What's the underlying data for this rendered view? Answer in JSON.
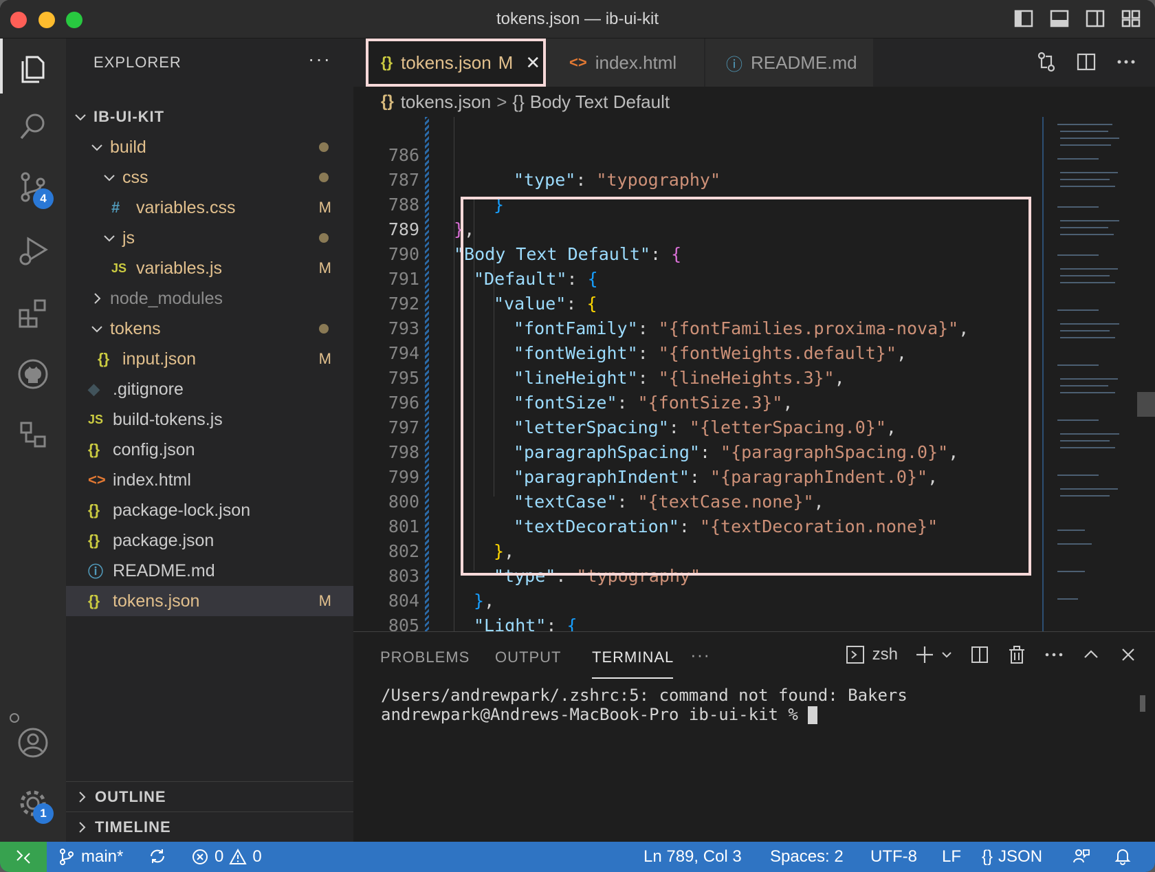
{
  "window": {
    "title": "tokens.json — ib-ui-kit"
  },
  "activity_bar": {
    "scm_badge": "4",
    "settings_badge": "1"
  },
  "sidebar": {
    "header": "EXPLORER",
    "more": "···",
    "root": "IB-UI-KIT",
    "tree": [
      {
        "label": "build",
        "icon": "",
        "git": "dot"
      },
      {
        "label": "css",
        "icon": "",
        "git": "dot"
      },
      {
        "label": "variables.css",
        "icon": "#",
        "git": "M"
      },
      {
        "label": "js",
        "icon": "",
        "git": "dot"
      },
      {
        "label": "variables.js",
        "icon": "JS",
        "git": "M"
      },
      {
        "label": "node_modules",
        "icon": "",
        "git": ""
      },
      {
        "label": "tokens",
        "icon": "",
        "git": "dot"
      },
      {
        "label": "input.json",
        "icon": "{}",
        "git": "M"
      },
      {
        "label": ".gitignore",
        "icon": "◆",
        "git": ""
      },
      {
        "label": "build-tokens.js",
        "icon": "JS",
        "git": ""
      },
      {
        "label": "config.json",
        "icon": "{}",
        "git": ""
      },
      {
        "label": "index.html",
        "icon": "<>",
        "git": ""
      },
      {
        "label": "package-lock.json",
        "icon": "{}",
        "git": ""
      },
      {
        "label": "package.json",
        "icon": "{}",
        "git": ""
      },
      {
        "label": "README.md",
        "icon": "ⓘ",
        "git": ""
      },
      {
        "label": "tokens.json",
        "icon": "{}",
        "git": "M"
      }
    ],
    "outline": "OUTLINE",
    "timeline": "TIMELINE"
  },
  "tabs": [
    {
      "label": "tokens.json",
      "icon": "{}",
      "status": "M",
      "close": "✕"
    },
    {
      "label": "index.html",
      "icon": "<>"
    },
    {
      "label": "README.md",
      "icon": "ⓘ"
    }
  ],
  "breadcrumb": {
    "icon1": "{}",
    "file": "tokens.json",
    "sep": ">",
    "icon2": "{}",
    "symbol": "Body Text Default"
  },
  "code": {
    "line_numbers": [
      "786",
      "787",
      "788",
      "789",
      "790",
      "791",
      "792",
      "793",
      "794",
      "795",
      "796",
      "797",
      "798",
      "799",
      "800",
      "801",
      "802",
      "803",
      "804",
      "805"
    ]
  },
  "panel": {
    "tabs": [
      "PROBLEMS",
      "OUTPUT",
      "TERMINAL"
    ],
    "more": "···",
    "shell": "zsh",
    "terminal_lines": [
      "/Users/andrewpark/.zshrc:5: command not found: Bakers",
      "andrewpark@Andrews-MacBook-Pro ib-ui-kit % "
    ]
  },
  "statusbar": {
    "branch": "main*",
    "errors": "0",
    "warnings": "0",
    "position": "Ln 789, Col 3",
    "spaces": "Spaces: 2",
    "encoding": "UTF-8",
    "eol": "LF",
    "language": "JSON",
    "language_icon": "{}"
  },
  "colors": {
    "accent": "#2f74c3",
    "modified": "#e2c08d",
    "highlight_border": "#f8d9d9",
    "remote": "#37a24f"
  }
}
